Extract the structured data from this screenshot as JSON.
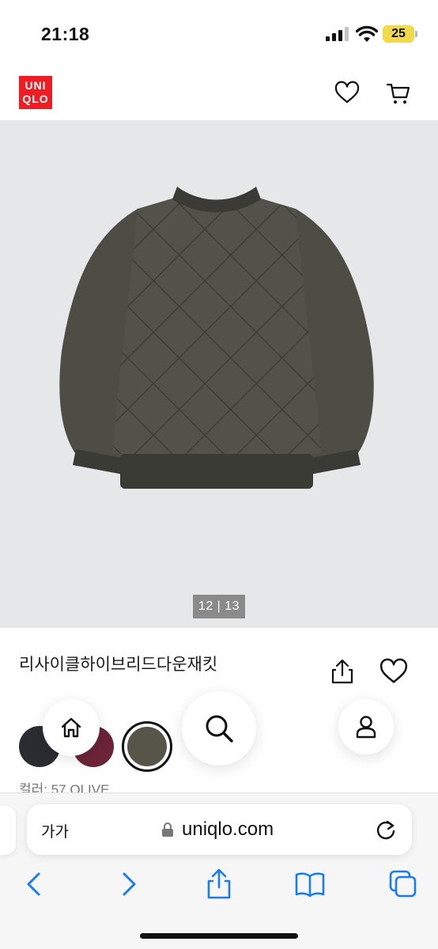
{
  "status_bar": {
    "time": "21:18",
    "battery": "25"
  },
  "header": {
    "logo_line1": "UNI",
    "logo_line2": "QLO",
    "logo_color": "#ed1d24"
  },
  "product_image": {
    "counter": "12 | 13"
  },
  "product": {
    "title": "리사이클하이브리드다운재킷",
    "colors": [
      {
        "name": "black",
        "hex": "#2b2c31"
      },
      {
        "name": "wine",
        "hex": "#6b2438"
      },
      {
        "name": "olive",
        "hex": "#575449",
        "selected": true
      }
    ],
    "color_label": "컬러: 57 OLIVE"
  },
  "floating_nav": {
    "icons": [
      "home-icon",
      "search-icon",
      "account-icon"
    ]
  },
  "safari": {
    "text_size_label": "가가",
    "url": "uniqlo.com"
  }
}
